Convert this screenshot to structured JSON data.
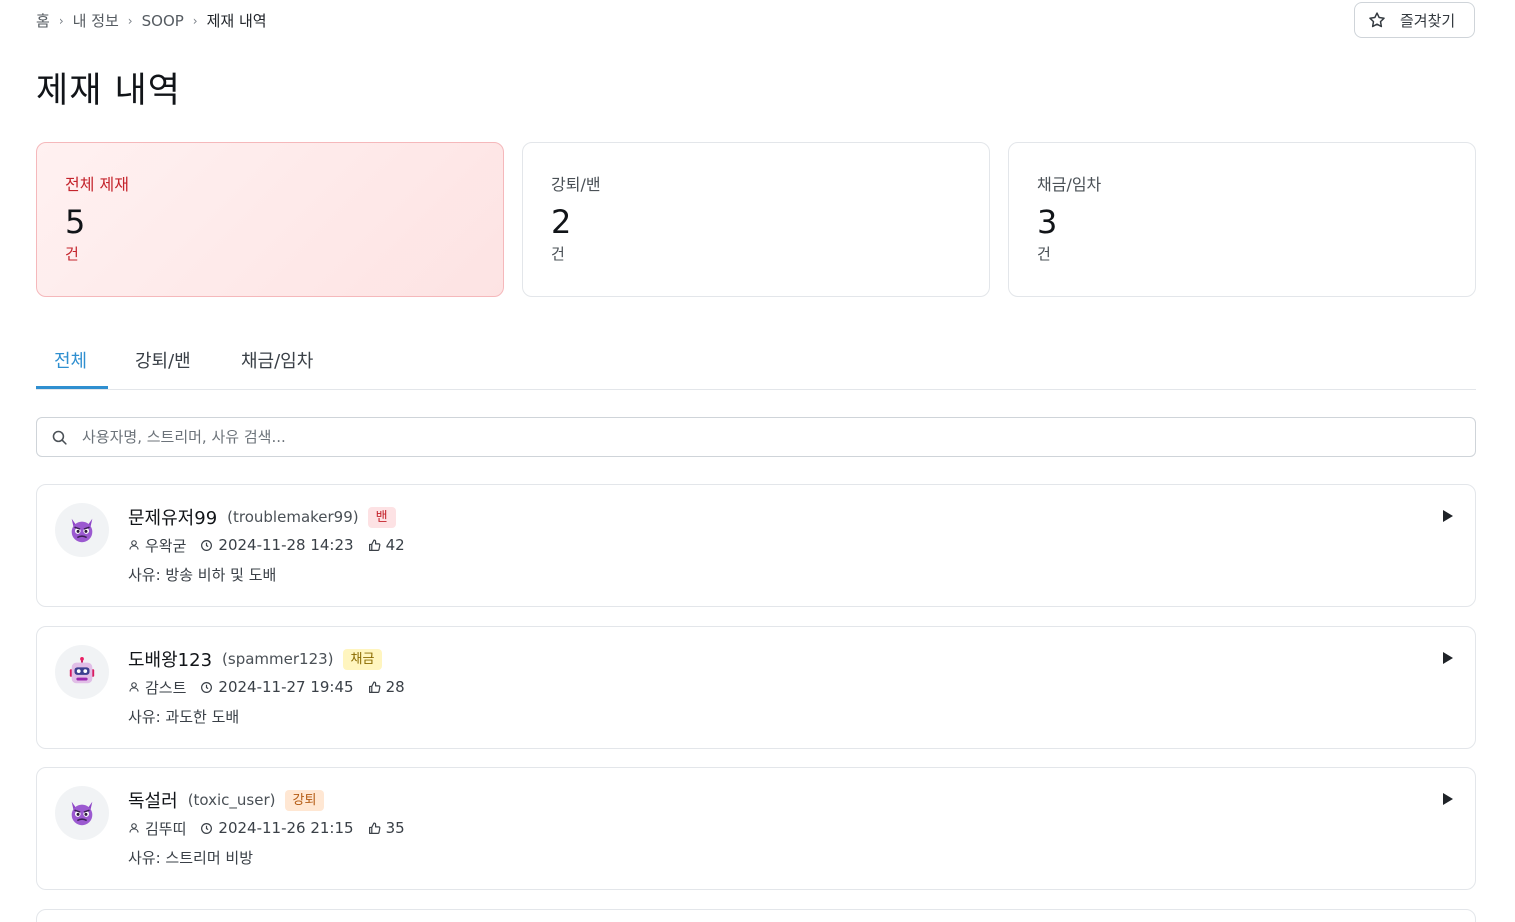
{
  "breadcrumb": {
    "items": [
      "홈",
      "내 정보",
      "SOOP",
      "제재 내역"
    ],
    "separator": "›"
  },
  "favorite_button": {
    "label": "즐겨찾기",
    "icon": "star-outline-icon"
  },
  "page_title": "제재 내역",
  "stats": [
    {
      "label": "전체 제재",
      "value": "5",
      "unit": "건",
      "active": true
    },
    {
      "label": "강퇴/밴",
      "value": "2",
      "unit": "건",
      "active": false
    },
    {
      "label": "채금/임차",
      "value": "3",
      "unit": "건",
      "active": false
    }
  ],
  "tabs": [
    {
      "label": "전체",
      "active": true
    },
    {
      "label": "강퇴/밴",
      "active": false
    },
    {
      "label": "채금/임차",
      "active": false
    }
  ],
  "search": {
    "placeholder": "사용자명, 스트리머, 사유 검색...",
    "value": ""
  },
  "sanctions": [
    {
      "nickname": "문제유저99",
      "user_id": "(troublemaker99)",
      "badge": "밴",
      "badge_type": "ban",
      "avatar_icon": "devil-face-icon",
      "streamer": "우왁굳",
      "datetime": "2024-11-28 14:23",
      "likes": "42",
      "reason": "사유: 방송 비하 및 도배"
    },
    {
      "nickname": "도배왕123",
      "user_id": "(spammer123)",
      "badge": "채금",
      "badge_type": "fine",
      "avatar_icon": "robot-face-icon",
      "streamer": "감스트",
      "datetime": "2024-11-27 19:45",
      "likes": "28",
      "reason": "사유: 과도한 도배"
    },
    {
      "nickname": "독설러",
      "user_id": "(toxic_user)",
      "badge": "강퇴",
      "badge_type": "kick",
      "avatar_icon": "devil-face-icon",
      "streamer": "김뚜띠",
      "datetime": "2024-11-26 21:15",
      "likes": "35",
      "reason": "사유: 스트리머 비방"
    }
  ],
  "colors": {
    "accent": "#2f8fd0",
    "danger": "#c4242c",
    "active_card_bg": "#fde3e3"
  }
}
